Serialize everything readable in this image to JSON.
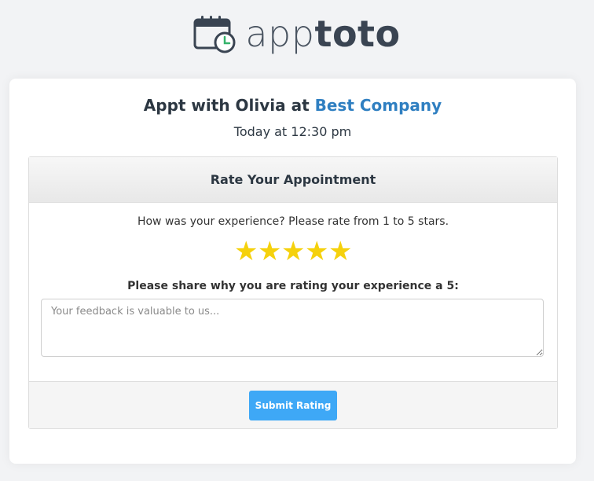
{
  "brand": {
    "logo_light": "app",
    "logo_bold": "toto",
    "icon": "calendar-clock-icon"
  },
  "appointment": {
    "title_prefix": "Appt with Olivia at ",
    "company": "Best Company",
    "time": "Today at 12:30 pm"
  },
  "rating_panel": {
    "header": "Rate Your Appointment",
    "question": "How was your experience? Please rate from 1 to 5 stars.",
    "rating": 5,
    "max_rating": 5,
    "star_glyph": "★",
    "share_label": "Please share why you are rating your experience a 5:",
    "feedback_value": "",
    "feedback_placeholder": "Your feedback is valuable to us...",
    "submit_label": "Submit Rating"
  },
  "colors": {
    "company_link": "#2f7fc1",
    "star": "#f5d10c",
    "submit_button": "#3ea8f6"
  }
}
